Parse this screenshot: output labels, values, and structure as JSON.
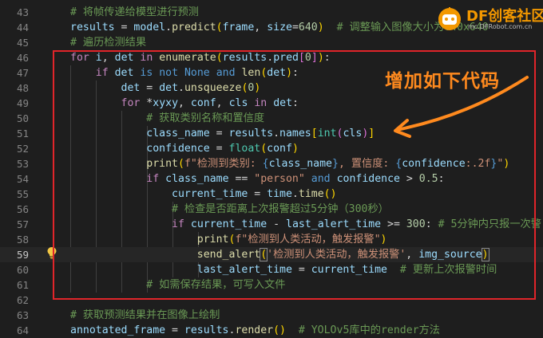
{
  "annotation": {
    "note": "增加如下代码",
    "highlight_color": "#e0252a",
    "note_color": "#ff8a1e"
  },
  "watermark": {
    "title": "DF创客社区",
    "subtitle": "mc.DFRobot.com.cn"
  },
  "editor": {
    "active_line": 59,
    "lines": [
      {
        "num": "43",
        "tokens": [
          {
            "t": "# 将帧传递给模型进行预测",
            "c": "cmt"
          }
        ]
      },
      {
        "num": "44",
        "tokens": [
          {
            "t": "results",
            "c": "var"
          },
          {
            "t": " = ",
            "c": ""
          },
          {
            "t": "model",
            "c": "var"
          },
          {
            "t": ".",
            "c": ""
          },
          {
            "t": "predict",
            "c": "fn"
          },
          {
            "t": "(",
            "c": "brk"
          },
          {
            "t": "frame",
            "c": "var"
          },
          {
            "t": ", ",
            "c": ""
          },
          {
            "t": "size",
            "c": "var"
          },
          {
            "t": "=",
            "c": ""
          },
          {
            "t": "640",
            "c": "num"
          },
          {
            "t": ")",
            "c": "brk"
          },
          {
            "t": "  # 调整输入图像大小为640x640",
            "c": "cmt"
          }
        ]
      },
      {
        "num": "45",
        "tokens": [
          {
            "t": "# 遍历检测结果",
            "c": "cmt"
          }
        ]
      },
      {
        "num": "46",
        "tokens": [
          {
            "t": "for",
            "c": "ctl"
          },
          {
            "t": " ",
            "c": ""
          },
          {
            "t": "i",
            "c": "var"
          },
          {
            "t": ", ",
            "c": ""
          },
          {
            "t": "det",
            "c": "var"
          },
          {
            "t": " ",
            "c": ""
          },
          {
            "t": "in",
            "c": "ctl"
          },
          {
            "t": " ",
            "c": ""
          },
          {
            "t": "enumerate",
            "c": "fn"
          },
          {
            "t": "(",
            "c": "brk"
          },
          {
            "t": "results",
            "c": "var"
          },
          {
            "t": ".",
            "c": ""
          },
          {
            "t": "pred",
            "c": "var"
          },
          {
            "t": "[",
            "c": "brk2"
          },
          {
            "t": "0",
            "c": "num"
          },
          {
            "t": "]",
            "c": "brk2"
          },
          {
            "t": ")",
            "c": "brk"
          },
          {
            "t": ":",
            "c": ""
          }
        ]
      },
      {
        "num": "47",
        "tokens": [
          {
            "t": "    ",
            "c": ""
          },
          {
            "t": "if",
            "c": "ctl"
          },
          {
            "t": " ",
            "c": ""
          },
          {
            "t": "det",
            "c": "var"
          },
          {
            "t": " ",
            "c": ""
          },
          {
            "t": "is not",
            "c": "kw"
          },
          {
            "t": " ",
            "c": ""
          },
          {
            "t": "None",
            "c": "kw"
          },
          {
            "t": " ",
            "c": ""
          },
          {
            "t": "and",
            "c": "kw"
          },
          {
            "t": " ",
            "c": ""
          },
          {
            "t": "len",
            "c": "fn"
          },
          {
            "t": "(",
            "c": "brk"
          },
          {
            "t": "det",
            "c": "var"
          },
          {
            "t": ")",
            "c": "brk"
          },
          {
            "t": ":",
            "c": ""
          }
        ]
      },
      {
        "num": "48",
        "tokens": [
          {
            "t": "        ",
            "c": ""
          },
          {
            "t": "det",
            "c": "var"
          },
          {
            "t": " = ",
            "c": ""
          },
          {
            "t": "det",
            "c": "var"
          },
          {
            "t": ".",
            "c": ""
          },
          {
            "t": "unsqueeze",
            "c": "fn"
          },
          {
            "t": "(",
            "c": "brk"
          },
          {
            "t": "0",
            "c": "num"
          },
          {
            "t": ")",
            "c": "brk"
          }
        ]
      },
      {
        "num": "49",
        "tokens": [
          {
            "t": "        ",
            "c": ""
          },
          {
            "t": "for",
            "c": "ctl"
          },
          {
            "t": " *",
            "c": ""
          },
          {
            "t": "xyxy",
            "c": "var"
          },
          {
            "t": ", ",
            "c": ""
          },
          {
            "t": "conf",
            "c": "var"
          },
          {
            "t": ", ",
            "c": ""
          },
          {
            "t": "cls",
            "c": "var"
          },
          {
            "t": " ",
            "c": ""
          },
          {
            "t": "in",
            "c": "ctl"
          },
          {
            "t": " ",
            "c": ""
          },
          {
            "t": "det",
            "c": "var"
          },
          {
            "t": ":",
            "c": ""
          }
        ]
      },
      {
        "num": "50",
        "tokens": [
          {
            "t": "            ",
            "c": ""
          },
          {
            "t": "# 获取类别名称和置信度",
            "c": "cmt"
          }
        ]
      },
      {
        "num": "51",
        "tokens": [
          {
            "t": "            ",
            "c": ""
          },
          {
            "t": "class_name",
            "c": "var"
          },
          {
            "t": " = ",
            "c": ""
          },
          {
            "t": "results",
            "c": "var"
          },
          {
            "t": ".",
            "c": ""
          },
          {
            "t": "names",
            "c": "var"
          },
          {
            "t": "[",
            "c": "brk"
          },
          {
            "t": "int",
            "c": "cls"
          },
          {
            "t": "(",
            "c": "brk2"
          },
          {
            "t": "cls",
            "c": "var"
          },
          {
            "t": ")",
            "c": "brk2"
          },
          {
            "t": "]",
            "c": "brk"
          }
        ]
      },
      {
        "num": "52",
        "tokens": [
          {
            "t": "            ",
            "c": ""
          },
          {
            "t": "confidence",
            "c": "var"
          },
          {
            "t": " = ",
            "c": ""
          },
          {
            "t": "float",
            "c": "cls"
          },
          {
            "t": "(",
            "c": "brk"
          },
          {
            "t": "conf",
            "c": "var"
          },
          {
            "t": ")",
            "c": "brk"
          }
        ]
      },
      {
        "num": "53",
        "tokens": [
          {
            "t": "            ",
            "c": ""
          },
          {
            "t": "print",
            "c": "fn"
          },
          {
            "t": "(",
            "c": "brk"
          },
          {
            "t": "f\"检测到类别: ",
            "c": "str"
          },
          {
            "t": "{",
            "c": "esc"
          },
          {
            "t": "class_name",
            "c": "var"
          },
          {
            "t": "}",
            "c": "esc"
          },
          {
            "t": ", 置信度: ",
            "c": "str"
          },
          {
            "t": "{",
            "c": "esc"
          },
          {
            "t": "confidence",
            "c": "var"
          },
          {
            "t": ":.2f",
            "c": "str"
          },
          {
            "t": "}",
            "c": "esc"
          },
          {
            "t": "\"",
            "c": "str"
          },
          {
            "t": ")",
            "c": "brk"
          }
        ]
      },
      {
        "num": "54",
        "tokens": [
          {
            "t": "            ",
            "c": ""
          },
          {
            "t": "if",
            "c": "ctl"
          },
          {
            "t": " ",
            "c": ""
          },
          {
            "t": "class_name",
            "c": "var"
          },
          {
            "t": " == ",
            "c": ""
          },
          {
            "t": "\"person\"",
            "c": "str"
          },
          {
            "t": " ",
            "c": ""
          },
          {
            "t": "and",
            "c": "kw"
          },
          {
            "t": " ",
            "c": ""
          },
          {
            "t": "confidence",
            "c": "var"
          },
          {
            "t": " > ",
            "c": ""
          },
          {
            "t": "0.5",
            "c": "num"
          },
          {
            "t": ":",
            "c": ""
          }
        ]
      },
      {
        "num": "55",
        "tokens": [
          {
            "t": "                ",
            "c": ""
          },
          {
            "t": "current_time",
            "c": "var"
          },
          {
            "t": " = ",
            "c": ""
          },
          {
            "t": "time",
            "c": "var"
          },
          {
            "t": ".",
            "c": ""
          },
          {
            "t": "time",
            "c": "fn"
          },
          {
            "t": "()",
            "c": "brk"
          }
        ]
      },
      {
        "num": "56",
        "tokens": [
          {
            "t": "                ",
            "c": ""
          },
          {
            "t": "# 检查是否距离上次报警超过5分钟（300秒）",
            "c": "cmt"
          }
        ]
      },
      {
        "num": "57",
        "tokens": [
          {
            "t": "                ",
            "c": ""
          },
          {
            "t": "if",
            "c": "ctl"
          },
          {
            "t": " ",
            "c": ""
          },
          {
            "t": "current_time",
            "c": "var"
          },
          {
            "t": " - ",
            "c": ""
          },
          {
            "t": "last_alert_time",
            "c": "var"
          },
          {
            "t": " >= ",
            "c": ""
          },
          {
            "t": "300",
            "c": "num"
          },
          {
            "t": ":",
            "c": ""
          },
          {
            "t": " # 5分钟内只报一次警",
            "c": "cmt"
          }
        ]
      },
      {
        "num": "58",
        "tokens": [
          {
            "t": "                    ",
            "c": ""
          },
          {
            "t": "print",
            "c": "fn"
          },
          {
            "t": "(",
            "c": "brk"
          },
          {
            "t": "f\"检测到人类活动，触发报警\"",
            "c": "str"
          },
          {
            "t": ")",
            "c": "brk"
          }
        ]
      },
      {
        "num": "59",
        "tokens": [
          {
            "t": "                    ",
            "c": ""
          },
          {
            "t": "send_alert",
            "c": "fn"
          },
          {
            "t": "(",
            "c": "brk box"
          },
          {
            "t": "'检测到人类活动，触发报警'",
            "c": "str"
          },
          {
            "t": ", ",
            "c": ""
          },
          {
            "t": "img_source",
            "c": "var"
          },
          {
            "t": ")",
            "c": "brk box"
          }
        ]
      },
      {
        "num": "60",
        "tokens": [
          {
            "t": "                    ",
            "c": ""
          },
          {
            "t": "last_alert_time",
            "c": "var"
          },
          {
            "t": " = ",
            "c": ""
          },
          {
            "t": "current_time",
            "c": "var"
          },
          {
            "t": "  # 更新上次报警时间",
            "c": "cmt"
          }
        ]
      },
      {
        "num": "61",
        "tokens": [
          {
            "t": "            ",
            "c": ""
          },
          {
            "t": "# 如需保存结果，可写入文件",
            "c": "cmt"
          }
        ]
      },
      {
        "num": "62",
        "tokens": []
      },
      {
        "num": "63",
        "tokens": [
          {
            "t": "# 获取预测结果并在图像上绘制",
            "c": "cmt"
          }
        ]
      },
      {
        "num": "64",
        "tokens": [
          {
            "t": "annotated_frame",
            "c": "var"
          },
          {
            "t": " = ",
            "c": ""
          },
          {
            "t": "results",
            "c": "var"
          },
          {
            "t": ".",
            "c": ""
          },
          {
            "t": "render",
            "c": "fn"
          },
          {
            "t": "()",
            "c": "brk"
          },
          {
            "t": "  # YOLOv5库中的render方法",
            "c": "cmt"
          }
        ]
      }
    ]
  }
}
